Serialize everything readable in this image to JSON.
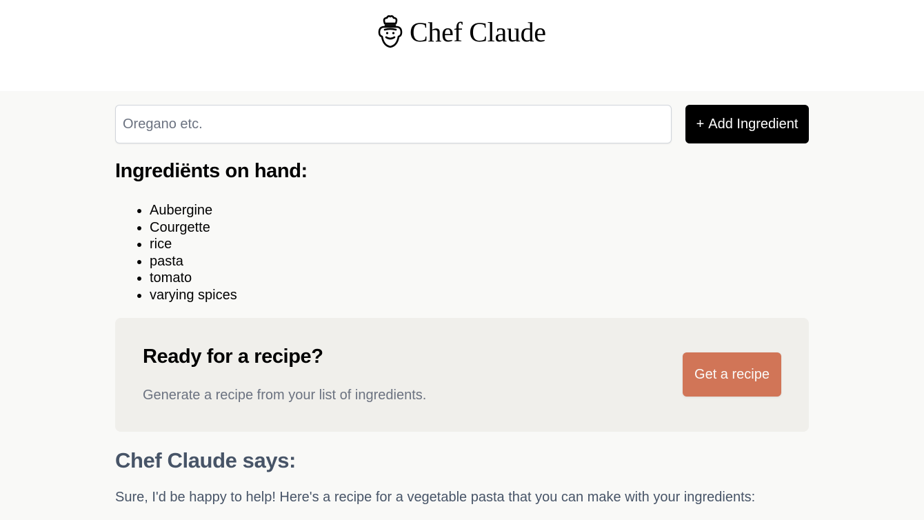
{
  "header": {
    "title": "Chef Claude",
    "icon": "chef-icon"
  },
  "form": {
    "placeholder": "Oregano etc.",
    "value": "",
    "add_button_icon": "plus-icon",
    "add_button_symbol": "+",
    "add_button_label": "Add Ingredient"
  },
  "ingredients": {
    "heading": "Ingrediënts on hand:",
    "items": [
      "Aubergine",
      "Courgette",
      "rice",
      "pasta",
      "tomato",
      "varying spices"
    ]
  },
  "recipe_card": {
    "title": "Ready for a recipe?",
    "subtitle": "Generate a recipe from your list of ingredients.",
    "button_label": "Get a recipe"
  },
  "response": {
    "heading": "Chef Claude says:",
    "text": "Sure, I'd be happy to help! Here's a recipe for a vegetable pasta that you can make with your ingredients:"
  },
  "colors": {
    "page_background": "#f9f9f7",
    "header_background": "#ffffff",
    "card_background": "#f0efeb",
    "accent_button": "#d17557",
    "primary_button": "#000000",
    "muted_text": "#6b7280",
    "response_text": "#475467"
  }
}
